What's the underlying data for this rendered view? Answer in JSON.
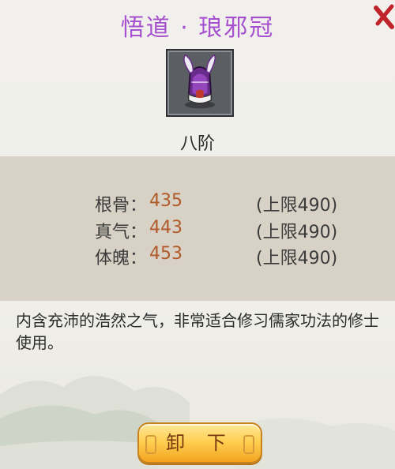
{
  "dialog": {
    "title": "悟道 · 琅邪冠",
    "item_icon": "purple-crown-icon",
    "rank": "八阶"
  },
  "stats": [
    {
      "name": "根骨：",
      "value": "435",
      "limit": "(上限490)"
    },
    {
      "name": "真气：",
      "value": "443",
      "limit": "(上限490)"
    },
    {
      "name": "体魄：",
      "value": "453",
      "limit": "(上限490)"
    }
  ],
  "description": "内含充沛的浩然之气，非常适合修习儒家功法的修士使用。",
  "actions": {
    "unequip_label": "卸 下"
  },
  "colors": {
    "title": "#a64fcf",
    "stat_value": "#b15a2a",
    "button": "#ffd052"
  }
}
